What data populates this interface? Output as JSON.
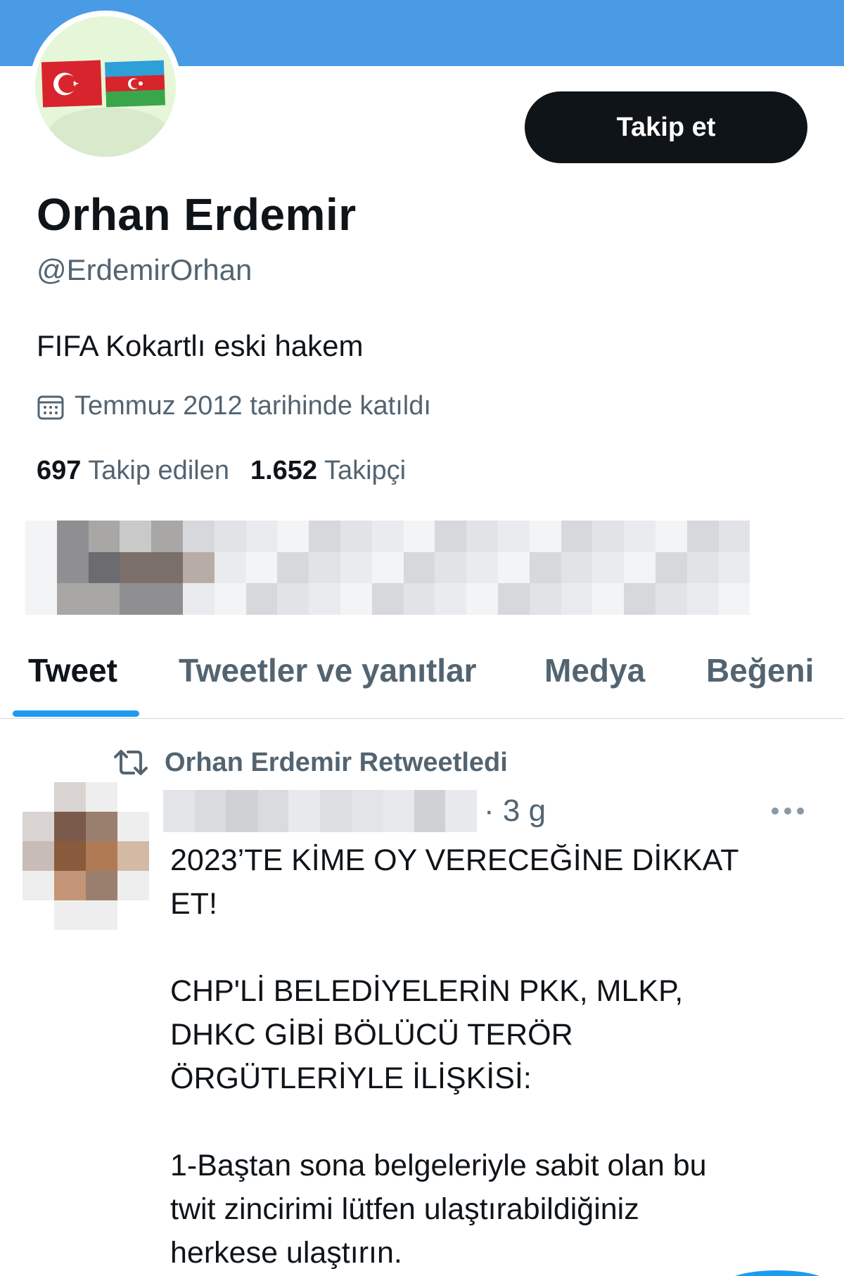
{
  "profile": {
    "name": "Orhan Erdemir",
    "handle": "@ErdemirOrhan",
    "bio": "FIFA Kokartlı eski hakem",
    "joined": "Temmuz 2012 tarihinde katıldı",
    "following_count": "697",
    "following_label": "Takip edilen",
    "followers_count": "1.652",
    "followers_label": "Takipçi",
    "follow_button": "Takip et"
  },
  "tabs": [
    {
      "label": "Tweet",
      "active": true
    },
    {
      "label": "Tweetler ve yanıtlar",
      "active": false
    },
    {
      "label": "Medya",
      "active": false
    },
    {
      "label": "Beğeni",
      "active": false
    }
  ],
  "tweet": {
    "retweet_label": "Orhan Erdemir Retweetledi",
    "time": "· 3 g",
    "paragraphs": [
      "2023’TE KİME OY VERECEĞİNE DİKKAT\nET!",
      "CHP'Lİ BELEDİYELERİN PKK, MLKP,\nDHKC GİBİ BÖLÜCÜ TERÖR\nÖRGÜTLERİYLE İLİŞKİSİ:",
      "1-Baştan sona belgeleriyle sabit olan bu\ntwit zincirimi lütfen ulaştırabildiğiniz\nherkese ulaştırın."
    ]
  },
  "colors": {
    "banner": "#4a9be6",
    "accent": "#1d9bf0",
    "text_primary": "#0f1419",
    "text_secondary": "#536471"
  },
  "icons": [
    "calendar-icon",
    "retweet-icon",
    "more-icon"
  ]
}
